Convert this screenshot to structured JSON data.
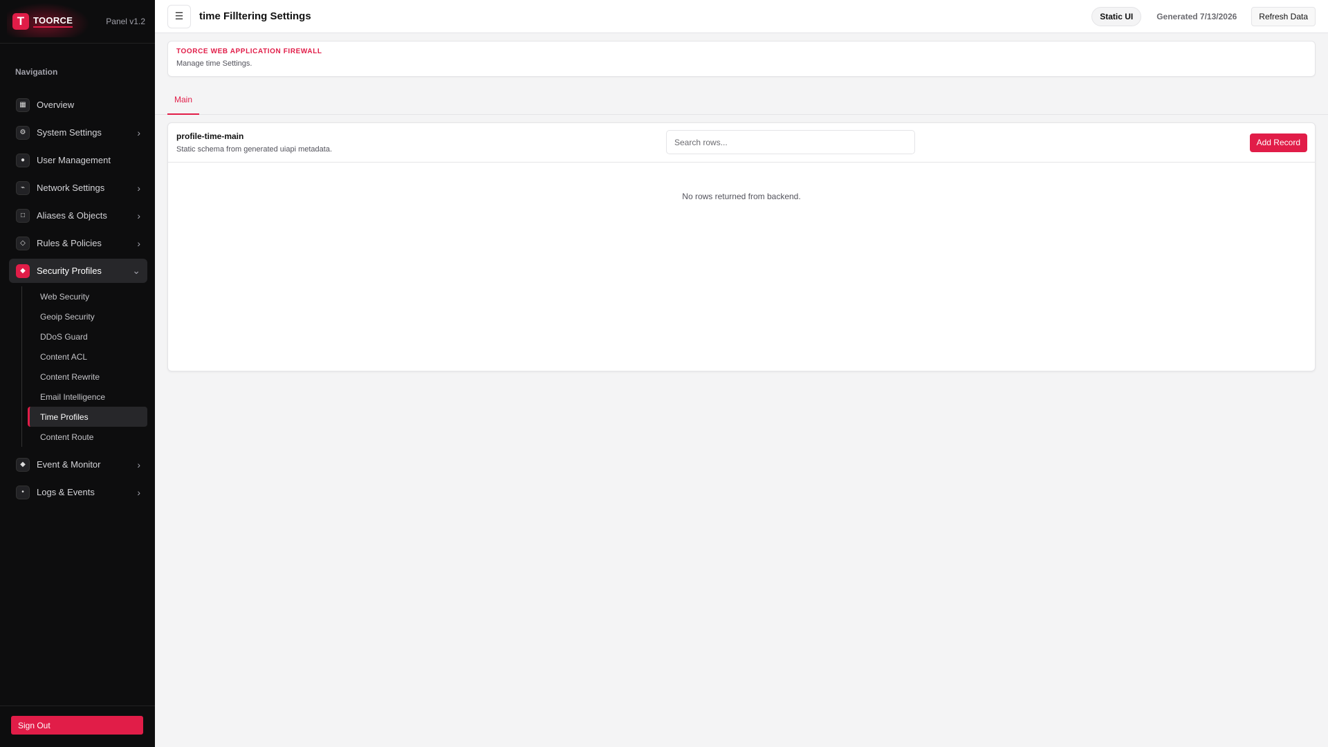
{
  "brand": {
    "logo_letter": "T",
    "name": "TOORCE",
    "version": "Panel v1.2"
  },
  "sidebar": {
    "heading": "Navigation",
    "items": [
      {
        "label": "Overview",
        "icon": "▦"
      },
      {
        "label": "System Settings",
        "icon": "⚙",
        "chevron": "›"
      },
      {
        "label": "User Management",
        "icon": "●"
      },
      {
        "label": "Network Settings",
        "icon": "⌁",
        "chevron": "›"
      },
      {
        "label": "Aliases & Objects",
        "icon": "□",
        "chevron": "›"
      },
      {
        "label": "Rules & Policies",
        "icon": "◇",
        "chevron": "›"
      },
      {
        "label": "Security Profiles",
        "icon": "◆",
        "chevron": "⌄"
      },
      {
        "label": "Event & Monitor",
        "icon": "◆",
        "chevron": "›"
      },
      {
        "label": "Logs & Events",
        "icon": "•",
        "chevron": "›"
      }
    ],
    "sub_items": [
      "Web Security",
      "Geoip Security",
      "DDoS Guard",
      "Content ACL",
      "Content Rewrite",
      "Email Intelligence",
      "Time Profiles",
      "Content Route"
    ],
    "sign_out": "Sign Out"
  },
  "topbar": {
    "menu_icon": "☰",
    "title": "time Filltering Settings",
    "static_badge": "Static UI",
    "generated": "Generated 7/13/2026",
    "refresh": "Refresh Data"
  },
  "header_card": {
    "eyebrow": "TOORCE WEB APPLICATION FIREWALL",
    "description": "Manage time Settings."
  },
  "tabs": [
    "Main"
  ],
  "table": {
    "name": "profile-time-main",
    "subtitle": "Static schema from generated uiapi metadata.",
    "search_placeholder": "Search rows...",
    "add_label": "Add Record",
    "empty_message": "No rows returned from backend."
  },
  "colors": {
    "accent": "#e11d48",
    "sidebar_bg": "#0d0d0e"
  }
}
